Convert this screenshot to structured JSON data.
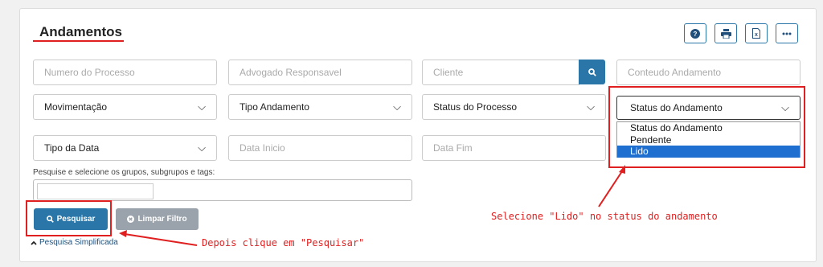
{
  "page": {
    "title": "Andamentos"
  },
  "toolbar": [
    {
      "icon": "help-icon"
    },
    {
      "icon": "printer-icon"
    },
    {
      "icon": "excel-icon"
    },
    {
      "icon": "more-icon"
    }
  ],
  "filters": {
    "numero_processo": {
      "placeholder": "Numero do Processo"
    },
    "advogado": {
      "placeholder": "Advogado Responsavel"
    },
    "cliente": {
      "placeholder": "Cliente"
    },
    "conteudo": {
      "placeholder": "Conteudo Andamento"
    },
    "movimentacao": {
      "value": "Movimentação"
    },
    "tipo_andamento": {
      "value": "Tipo Andamento"
    },
    "status_processo": {
      "value": "Status do Processo"
    },
    "status_andamento": {
      "value": "Status do Andamento",
      "options": [
        "Status do Andamento",
        "Pendente",
        "Lido"
      ],
      "selected_option": "Lido"
    },
    "tipo_data": {
      "value": "Tipo da Data"
    },
    "data_inicio": {
      "placeholder": "Data Inicio"
    },
    "data_fim": {
      "placeholder": "Data Fim"
    }
  },
  "tags": {
    "hint": "Pesquise e selecione os grupos, subgrupos e tags:"
  },
  "buttons": {
    "pesquisar": "Pesquisar",
    "limpar": "Limpar Filtro",
    "pesquisa_simplificada": "Pesquisa Simplificada"
  },
  "annotations": {
    "select_lido": "Selecione \"Lido\" no status do andamento",
    "click_pesquisar": "Depois clique em \"Pesquisar\""
  },
  "colors": {
    "primary": "#2a76a8",
    "annotation_red": "#e02020",
    "selected_option": "#1e6fd0",
    "grey_button": "#9aa3ab"
  }
}
